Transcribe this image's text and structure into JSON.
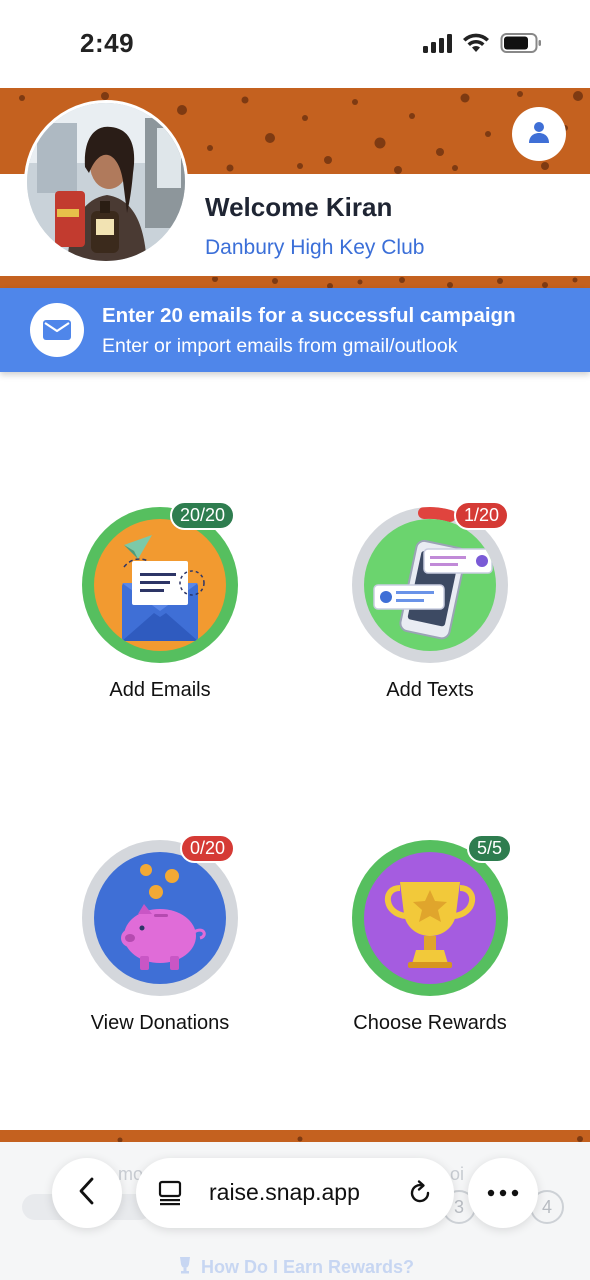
{
  "status_bar": {
    "time": "2:49",
    "signal_icon": "cellular-signal-icon",
    "wifi_icon": "wifi-icon",
    "battery_icon": "battery-icon"
  },
  "header": {
    "welcome": "Welcome Kiran",
    "club": "Danbury High Key Club",
    "pattern_color": "#c4611f",
    "profile_icon": "user-icon"
  },
  "banner": {
    "title": "Enter 20 emails for a successful campaign",
    "subtitle": "Enter or import emails from gmail/outlook",
    "icon": "envelope-icon",
    "color": "#4f86ea"
  },
  "tiles": [
    {
      "label": "Add Emails",
      "badge": "20/20",
      "progress": 1.0,
      "icon": "email-envelope-icon"
    },
    {
      "label": "Add Texts",
      "badge": "1/20",
      "progress": 0.05,
      "icon": "phone-messages-icon"
    },
    {
      "label": "View Donations",
      "badge": "0/20",
      "progress": 0.0,
      "icon": "piggy-bank-icon"
    },
    {
      "label": "Choose Rewards",
      "badge": "5/5",
      "progress": 1.0,
      "icon": "trophy-icon"
    }
  ],
  "under_browser": {
    "partial_left": "mo",
    "partial_right": "oi",
    "step3": "3",
    "step4": "4",
    "earn_rewards": "How Do I Earn Rewards?"
  },
  "browser": {
    "url": "raise.snap.app",
    "back_icon": "chevron-left-icon",
    "reader_icon": "reader-mode-icon",
    "reload_icon": "reload-icon",
    "more_icon": "more-dots-icon"
  }
}
